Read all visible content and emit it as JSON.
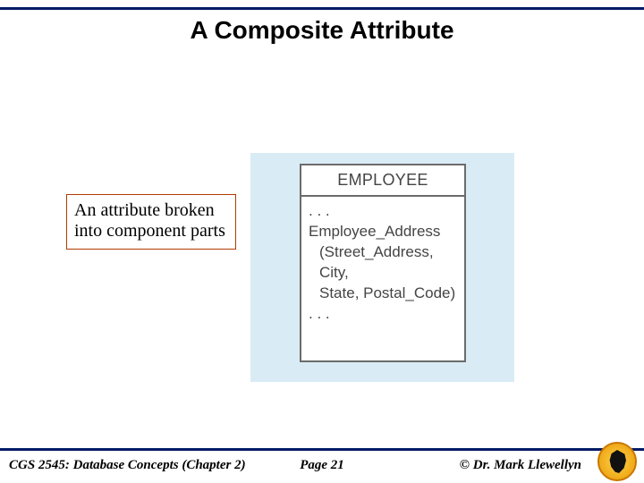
{
  "title": "A Composite Attribute",
  "callout": {
    "text": "An attribute broken into component parts"
  },
  "diagram": {
    "entity_name": "EMPLOYEE",
    "ellipsis_top": ". . .",
    "attribute": "Employee_Address",
    "components_line1": "(Street_Address, City,",
    "components_line2": "State, Postal_Code)",
    "ellipsis_bottom": ". . ."
  },
  "footer": {
    "left": "CGS 2545: Database Concepts  (Chapter 2)",
    "center": "Page 21",
    "right": "© Dr. Mark Llewellyn"
  }
}
